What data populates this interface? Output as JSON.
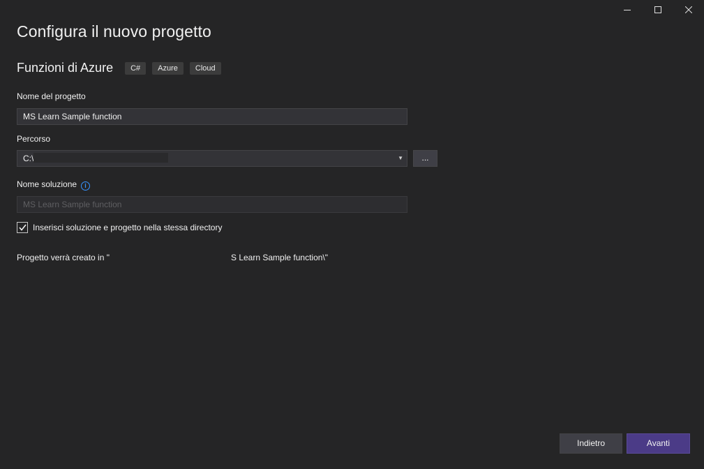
{
  "window": {
    "caption_icons": [
      "minimize-icon",
      "maximize-icon",
      "close-icon"
    ]
  },
  "page": {
    "title": "Configura il nuovo progetto"
  },
  "template": {
    "name": "Funzioni di Azure",
    "tags": [
      "C#",
      "Azure",
      "Cloud"
    ]
  },
  "project_name": {
    "label": "Nome del progetto",
    "value": "MS Learn Sample function"
  },
  "location": {
    "label": "Percorso",
    "value": "C:\\",
    "browse_label": "..."
  },
  "solution_name": {
    "label": "Nome soluzione",
    "value": "MS Learn Sample function"
  },
  "same_directory": {
    "label": "Inserisci soluzione e progetto nella stessa directory",
    "checked": true
  },
  "created_in": {
    "prefix": "Progetto verrà creato in \"",
    "suffix": "S Learn Sample function\\\""
  },
  "footer": {
    "back_label": "Indietro",
    "next_label": "Avanti"
  },
  "colors": {
    "background": "#252526",
    "accent": "#4b3b87",
    "info": "#3794ff"
  }
}
